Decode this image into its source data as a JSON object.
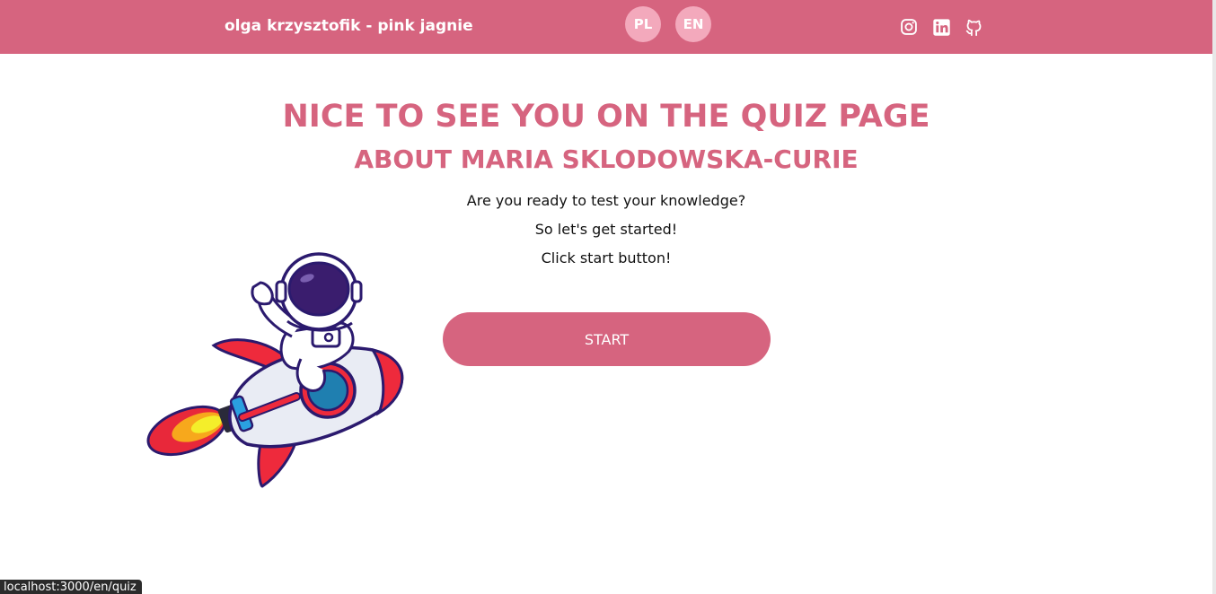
{
  "header": {
    "brand": "olga krzysztofik - pink jagnie",
    "languages": [
      {
        "label": "PL"
      },
      {
        "label": "EN"
      }
    ],
    "social": [
      {
        "icon": "instagram-icon"
      },
      {
        "icon": "linkedin-icon"
      },
      {
        "icon": "github-icon"
      }
    ]
  },
  "main": {
    "title": "NICE TO SEE YOU ON THE QUIZ PAGE",
    "subtitle": "ABOUT MARIA SKLODOWSKA-CURIE",
    "lines": [
      "Are you ready to test your knowledge?",
      "So let's get started!",
      "Click start button!"
    ],
    "start_label": "START",
    "illustration_icon": "astronaut-rocket-illustration"
  },
  "status_bar": {
    "url": "localhost:3000/en/quiz"
  },
  "colors": {
    "accent": "#d6647f",
    "language_badge": "#f3a9bc",
    "text": "#111111",
    "background": "#ffffff"
  }
}
